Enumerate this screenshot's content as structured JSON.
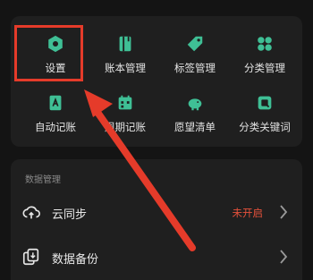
{
  "colors": {
    "accent": "#3fbf95",
    "warning": "#e5513b",
    "annotation": "#e53b2a"
  },
  "grid": [
    {
      "label": "设置",
      "icon": "gear-icon"
    },
    {
      "label": "账本管理",
      "icon": "ledger-book-icon"
    },
    {
      "label": "标签管理",
      "icon": "tag-icon"
    },
    {
      "label": "分类管理",
      "icon": "category-grid-icon"
    },
    {
      "label": "自动记账",
      "icon": "auto-entry-icon"
    },
    {
      "label": "周期记账",
      "icon": "calendar-icon"
    },
    {
      "label": "愿望清单",
      "icon": "piggy-bank-icon"
    },
    {
      "label": "分类关键词",
      "icon": "keyword-icon"
    }
  ],
  "data_section": {
    "title": "数据管理",
    "rows": [
      {
        "label": "云同步",
        "status": "未开启",
        "icon": "cloud-sync-icon"
      },
      {
        "label": "数据备份",
        "status": "",
        "icon": "backup-icon"
      }
    ]
  }
}
